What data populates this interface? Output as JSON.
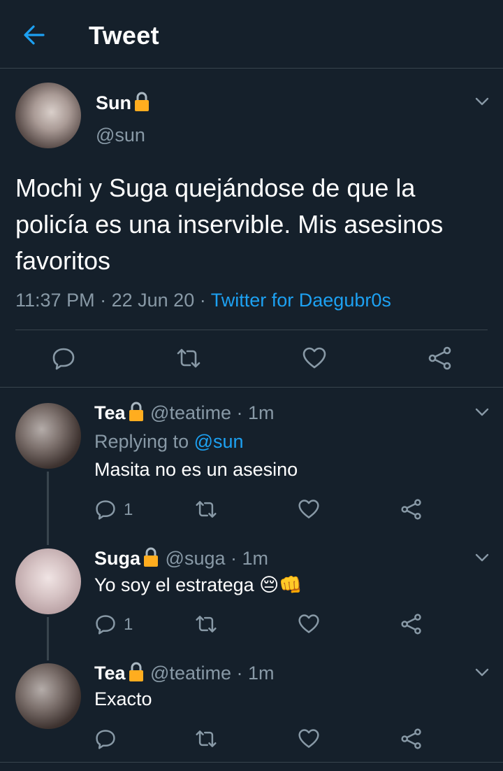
{
  "header": {
    "title": "Tweet"
  },
  "main_tweet": {
    "name": "Sun",
    "handle": "@sun",
    "text": "Mochi y Suga quejándose de que la policía es una inservible. Mis asesinos favoritos",
    "time": "11:37 PM",
    "date": "22 Jun 20",
    "source": "Twitter for Daegubr0s"
  },
  "replies": [
    {
      "name": "Tea",
      "handle": "@teatime",
      "time": "1m",
      "replying_prefix": "Replying to",
      "replying_to": "@sun",
      "text": "Masita no es un asesino",
      "reply_count": "1"
    },
    {
      "name": "Suga",
      "handle": "@suga",
      "time": "1m",
      "text": "Yo soy el estratega 😔👊",
      "reply_count": "1"
    },
    {
      "name": "Tea",
      "handle": "@teatime",
      "time": "1m",
      "text": "Exacto",
      "reply_count": ""
    }
  ],
  "separator": "·",
  "colors": {
    "background": "#15202b",
    "accent": "#1da1f2",
    "muted": "#8899a6",
    "border": "#38444d",
    "lock": "#ffad1f"
  },
  "icons": [
    "back-arrow-icon",
    "lock-icon",
    "chevron-down-icon",
    "reply-icon",
    "retweet-icon",
    "like-icon",
    "share-icon"
  ]
}
